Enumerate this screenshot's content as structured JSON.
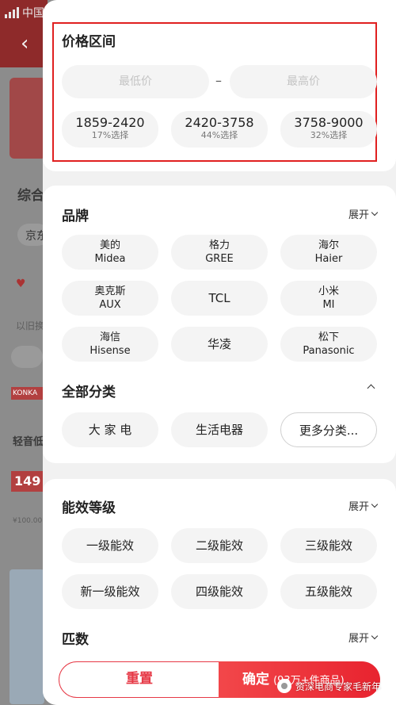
{
  "background": {
    "status_carrier": "中国",
    "sort_label": "综合",
    "chip_label": "京东",
    "brand_tag": "KONKA",
    "product_title": "轻音低",
    "price_fragment": "149",
    "coupon_text": "¥100.00",
    "note_text": "以旧换"
  },
  "price_section": {
    "title": "价格区间",
    "min_placeholder": "最低价",
    "max_placeholder": "最高价",
    "separator": "–",
    "ranges": [
      {
        "range": "1859-2420",
        "share": "17%选择"
      },
      {
        "range": "2420-3758",
        "share": "44%选择"
      },
      {
        "range": "3758-9000",
        "share": "32%选择"
      }
    ]
  },
  "brand_section": {
    "title": "品牌",
    "expand_label": "展开",
    "brands": [
      {
        "cn": "美的",
        "en": "Midea"
      },
      {
        "cn": "格力",
        "en": "GREE"
      },
      {
        "cn": "海尔",
        "en": "Haier"
      },
      {
        "cn": "奥克斯",
        "en": "AUX"
      },
      {
        "cn": "TCL",
        "en": ""
      },
      {
        "cn": "小米",
        "en": "MI"
      },
      {
        "cn": "海信",
        "en": "Hisense"
      },
      {
        "cn": "华凌",
        "en": ""
      },
      {
        "cn": "松下",
        "en": "Panasonic"
      }
    ]
  },
  "category_section": {
    "title": "全部分类",
    "items": [
      "大 家 电",
      "生活电器",
      "更多分类..."
    ]
  },
  "energy_section": {
    "title": "能效等级",
    "expand_label": "展开",
    "items": [
      "一级能效",
      "二级能效",
      "三级能效",
      "新一级能效",
      "四级能效",
      "五级能效"
    ]
  },
  "horsepower_section": {
    "title": "匹数",
    "expand_label": "展开"
  },
  "footer": {
    "reset_label": "重置",
    "confirm_label": "确定",
    "confirm_count": "(93万+件商品)"
  },
  "watermark": "资深电商专家毛新年",
  "colors": {
    "accent": "#e63946",
    "highlight_box": "#e02020",
    "battery": "#3ccf5a"
  }
}
